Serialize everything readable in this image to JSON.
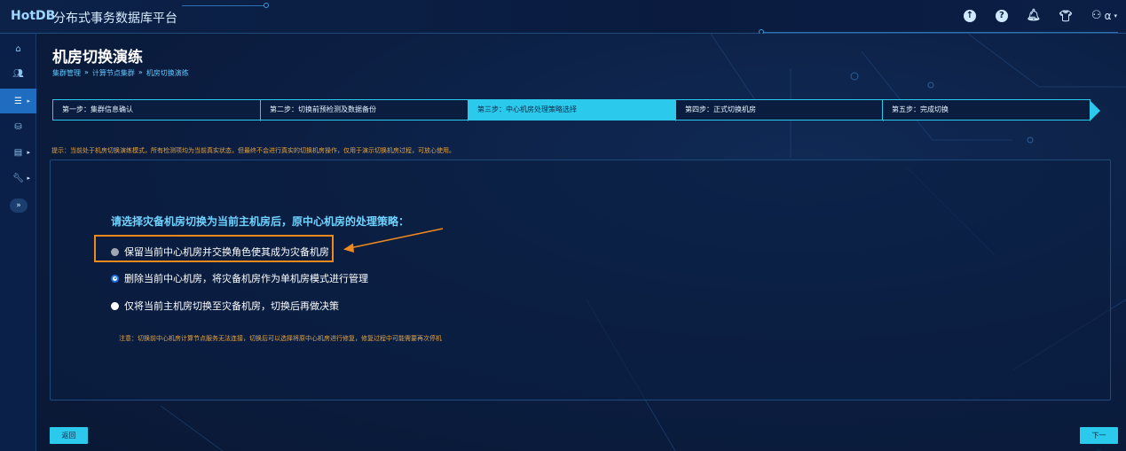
{
  "header": {
    "logo": "HotDB",
    "app_title": "分布式事务数据库平台",
    "icons": [
      "upload-icon",
      "help-icon",
      "bell-icon",
      "shirt-icon",
      "user-icon"
    ],
    "user_name": "α"
  },
  "sidebar": {
    "items": [
      {
        "icon": "home-icon"
      },
      {
        "icon": "users-icon"
      },
      {
        "icon": "server-icon",
        "active": true
      },
      {
        "icon": "database-icon"
      },
      {
        "icon": "report-icon"
      },
      {
        "icon": "wrench-icon"
      }
    ],
    "toggle_label": "»"
  },
  "page": {
    "title": "机房切换演练",
    "breadcrumb": [
      "集群管理",
      "计算节点集群",
      "机房切换演练"
    ],
    "breadcrumb_sep": "»"
  },
  "steps": [
    {
      "label": "第一步：集群信息确认"
    },
    {
      "label": "第二步：切换前预检测及数据备份"
    },
    {
      "label": "第三步：中心机房处理策略选择",
      "current": true
    },
    {
      "label": "第四步：正式切换机房"
    },
    {
      "label": "第五步：完成切换"
    }
  ],
  "tip": "提示：当前处于机房切换演练模式，所有检测项均为当前真实状态，但最终不会进行真实的切换机房操作，仅用于演示切换机房过程，可放心使用。",
  "panel": {
    "question": "请选择灾备机房切换为当前主机房后，原中心机房的处理策略：",
    "options": [
      {
        "label": "保留当前中心机房并交换角色使其成为灾备机房",
        "state": "disabled"
      },
      {
        "label": "删除当前中心机房，将灾备机房作为单机房模式进行管理",
        "state": "checked"
      },
      {
        "label": "仅将当前主机房切换至灾备机房，切换后再做决策",
        "state": "unchecked"
      }
    ],
    "note": "注意：切换前中心机房计算节点服务无法连接，切换后可以选择将原中心机房进行修复，修复过程中可能需要再次停机"
  },
  "buttons": {
    "back": "返回",
    "next": "下一步"
  },
  "colors": {
    "accent": "#2bc9ec",
    "warning": "#e2a445",
    "highlight": "#f08a1c",
    "question": "#6fd3ff"
  }
}
